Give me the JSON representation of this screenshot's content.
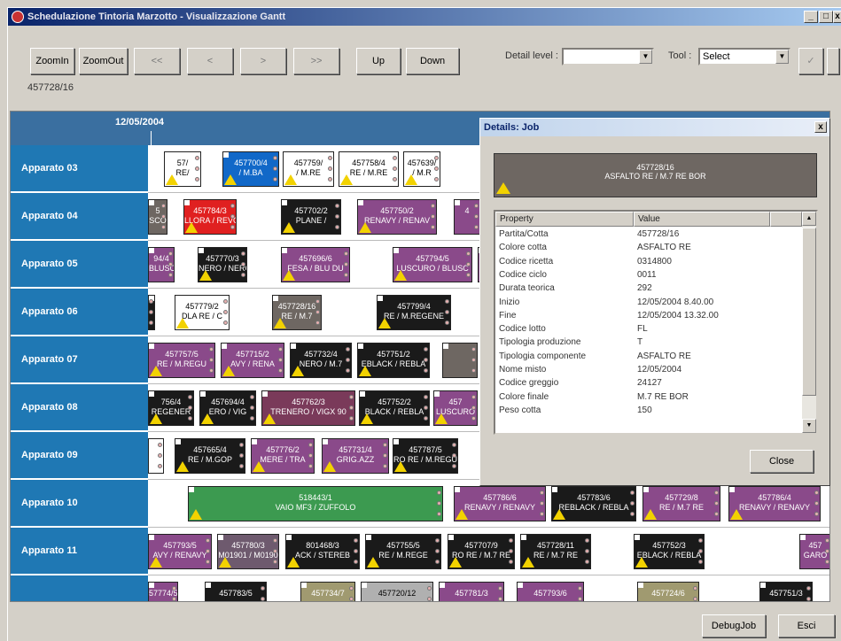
{
  "window": {
    "title": "Schedulazione Tintoria Marzotto - Visualizzazione Gantt",
    "minimize": "_",
    "maximize": "□",
    "close": "x"
  },
  "toolbar": {
    "zoomin": "ZoomIn",
    "zoomout": "ZoomOut",
    "first": "<<",
    "prev": "<",
    "next": ">",
    "last": ">>",
    "up": "Up",
    "down": "Down",
    "detail_label": "Detail level :",
    "detail_value": "",
    "tool_label": "Tool :",
    "tool_value": "Select",
    "check": "✓",
    "selected_job": "457728/16"
  },
  "gantt": {
    "date": "12/05/2004",
    "rows": [
      {
        "label": "Apparato 03",
        "jobs": [
          {
            "l1": "57/",
            "l2": "RE/",
            "color": "#ffffff",
            "text": "#000"
          },
          {
            "l1": "457700/4",
            "l2": "/ M.BA",
            "color": "#1168c8",
            "text": "#fff"
          },
          {
            "l1": "457759/",
            "l2": "/ M.RE",
            "color": "#ffffff",
            "text": "#000"
          },
          {
            "l1": "457758/4",
            "l2": "RE / M.RE",
            "color": "#ffffff",
            "text": "#000"
          },
          {
            "l1": "457639/",
            "l2": "/ M.R",
            "color": "#ffffff",
            "text": "#000"
          }
        ]
      },
      {
        "label": "Apparato 04",
        "jobs": [
          {
            "l1": "5",
            "l2": "SCO",
            "color": "#6e6762",
            "text": "#fff"
          },
          {
            "l1": "457784/3",
            "l2": "LLORA / REVO",
            "color": "#e02020",
            "text": "#fff"
          },
          {
            "l1": "457702/2",
            "l2": "PLANE /",
            "color": "#1a1a1a",
            "text": "#fff"
          },
          {
            "l1": "457750/2",
            "l2": "RENAVY / RENAV",
            "color": "#8a4a8a",
            "text": "#fff"
          },
          {
            "l1": "4",
            "l2": "",
            "color": "#8a4a8a",
            "text": "#fff"
          }
        ]
      },
      {
        "label": "Apparato 05",
        "jobs": [
          {
            "l1": "94/4",
            "l2": "BLUSCU",
            "color": "#8a4a8a",
            "text": "#fff"
          },
          {
            "l1": "457770/3",
            "l2": "NERO / NERO",
            "color": "#1a1a1a",
            "text": "#fff"
          },
          {
            "l1": "457696/6",
            "l2": "FESA / BLU DU",
            "color": "#8a4a8a",
            "text": "#fff"
          },
          {
            "l1": "457794/5",
            "l2": "LUSCURO / BLUSC",
            "color": "#8a4a8a",
            "text": "#fff"
          },
          {
            "l1": "4",
            "l2": "",
            "color": "#8a4a8a",
            "text": "#fff"
          }
        ]
      },
      {
        "label": "Apparato 06",
        "jobs": [
          {
            "l1": "",
            "l2": "",
            "color": "#1a1a1a",
            "text": "#fff"
          },
          {
            "l1": "457779/2",
            "l2": "DLA RE / C",
            "color": "#ffffff",
            "text": "#000"
          },
          {
            "l1": "457728/16",
            "l2": "RE / M.7",
            "color": "#6e6762",
            "text": "#fff"
          },
          {
            "l1": "457799/4",
            "l2": "RE / M.REGENE",
            "color": "#1a1a1a",
            "text": "#fff"
          }
        ]
      },
      {
        "label": "Apparato 07",
        "jobs": [
          {
            "l1": "457757/5",
            "l2": "RE / M.REGU",
            "color": "#8a4a8a",
            "text": "#fff"
          },
          {
            "l1": "457715/2",
            "l2": "AVY / RENA",
            "color": "#8a4a8a",
            "text": "#fff"
          },
          {
            "l1": "457732/4",
            "l2": "NERO / M.7",
            "color": "#1a1a1a",
            "text": "#fff"
          },
          {
            "l1": "457751/2",
            "l2": "EBLACK / REBLA",
            "color": "#1a1a1a",
            "text": "#fff"
          },
          {
            "l1": "",
            "l2": "",
            "color": "#6e6762",
            "text": "#fff"
          }
        ]
      },
      {
        "label": "Apparato 08",
        "jobs": [
          {
            "l1": "756/4",
            "l2": "REGENER",
            "color": "#1a1a1a",
            "text": "#fff"
          },
          {
            "l1": "457694/4",
            "l2": "ERO / VIG",
            "color": "#1a1a1a",
            "text": "#fff"
          },
          {
            "l1": "457762/3",
            "l2": "TRENERO / VIGX 90",
            "color": "#7a3a5a",
            "text": "#fff"
          },
          {
            "l1": "457752/2",
            "l2": "BLACK / REBLA",
            "color": "#1a1a1a",
            "text": "#fff"
          },
          {
            "l1": "457",
            "l2": "LUSCURO",
            "color": "#8a4a8a",
            "text": "#fff"
          }
        ]
      },
      {
        "label": "Apparato 09",
        "jobs": [
          {
            "l1": "",
            "l2": "",
            "color": "#ffffff",
            "text": "#000"
          },
          {
            "l1": "457665/4",
            "l2": "RE / M.GOP",
            "color": "#1a1a1a",
            "text": "#fff"
          },
          {
            "l1": "457776/2",
            "l2": "MERE / TRA",
            "color": "#8a4a8a",
            "text": "#fff"
          },
          {
            "l1": "457731/4",
            "l2": "GRIG.AZZ",
            "color": "#8a4a8a",
            "text": "#fff"
          },
          {
            "l1": "457787/5",
            "l2": "RO RE / M.REGU",
            "color": "#1a1a1a",
            "text": "#fff"
          }
        ]
      },
      {
        "label": "Apparato 10",
        "jobs": [
          {
            "l1": "518443/1",
            "l2": "VAIO MF3 / ZUFFOLO",
            "color": "#3c9a50",
            "text": "#fff"
          },
          {
            "l1": "457786/6",
            "l2": "RENAVY / RENAVY",
            "color": "#8a4a8a",
            "text": "#fff"
          },
          {
            "l1": "457783/6",
            "l2": "REBLACK / REBLA",
            "color": "#1a1a1a",
            "text": "#fff"
          },
          {
            "l1": "457729/8",
            "l2": "RE / M.7 RE",
            "color": "#8a4a8a",
            "text": "#fff"
          },
          {
            "l1": "457786/4",
            "l2": "RENAVY / RENAVY",
            "color": "#8a4a8a",
            "text": "#fff"
          }
        ]
      },
      {
        "label": "Apparato 11",
        "jobs": [
          {
            "l1": "457793/5",
            "l2": "AVY / RENAVY",
            "color": "#8a4a8a",
            "text": "#fff"
          },
          {
            "l1": "457780/3",
            "l2": "M01901 / M0190",
            "color": "#6e5a6e",
            "text": "#fff"
          },
          {
            "l1": "801468/3",
            "l2": "ACK / STEREB",
            "color": "#1a1a1a",
            "text": "#fff"
          },
          {
            "l1": "457755/5",
            "l2": "RE / M.REGE",
            "color": "#1a1a1a",
            "text": "#fff"
          },
          {
            "l1": "457707/9",
            "l2": "RO RE / M.7 RE",
            "color": "#1a1a1a",
            "text": "#fff"
          },
          {
            "l1": "457728/11",
            "l2": "RE / M.7 RE",
            "color": "#1a1a1a",
            "text": "#fff"
          },
          {
            "l1": "457752/3",
            "l2": "EBLACK / REBLA",
            "color": "#1a1a1a",
            "text": "#fff"
          },
          {
            "l1": "457",
            "l2": "GARO",
            "color": "#8a4a8a",
            "text": "#fff"
          }
        ]
      },
      {
        "label": "",
        "jobs": [
          {
            "l1": "57774/5",
            "l2": "",
            "color": "#8a4a8a",
            "text": "#fff"
          },
          {
            "l1": "457783/5",
            "l2": "",
            "color": "#1a1a1a",
            "text": "#fff"
          },
          {
            "l1": "457734/7",
            "l2": "",
            "color": "#a09a70",
            "text": "#fff"
          },
          {
            "l1": "457720/12",
            "l2": "",
            "color": "#b0b0b0",
            "text": "#000"
          },
          {
            "l1": "457781/3",
            "l2": "",
            "color": "#8a4a8a",
            "text": "#fff"
          },
          {
            "l1": "457793/6",
            "l2": "",
            "color": "#8a4a8a",
            "text": "#fff"
          },
          {
            "l1": "457724/6",
            "l2": "",
            "color": "#a09a70",
            "text": "#fff"
          },
          {
            "l1": "457751/3",
            "l2": "",
            "color": "#1a1a1a",
            "text": "#fff"
          }
        ]
      }
    ]
  },
  "details": {
    "title": "Details: Job",
    "close_x": "x",
    "job_id": "457728/16",
    "job_desc": "ASFALTO RE / M.7 RE BOR",
    "col_property": "Property",
    "col_value": "Value",
    "props": [
      {
        "k": "Partita/Cotta",
        "v": "457728/16"
      },
      {
        "k": "Colore cotta",
        "v": "ASFALTO RE"
      },
      {
        "k": "Codice ricetta",
        "v": "0314800"
      },
      {
        "k": "Codice ciclo",
        "v": "0011"
      },
      {
        "k": "Durata teorica",
        "v": "292"
      },
      {
        "k": "Inizio",
        "v": "12/05/2004 8.40.00"
      },
      {
        "k": "Fine",
        "v": "12/05/2004 13.32.00"
      },
      {
        "k": "Codice lotto",
        "v": "FL"
      },
      {
        "k": "Tipologia produzione",
        "v": "T"
      },
      {
        "k": "Tipologia componente",
        "v": "ASFALTO RE"
      },
      {
        "k": "Nome misto",
        "v": "12/05/2004"
      },
      {
        "k": "Codice greggio",
        "v": "24127"
      },
      {
        "k": "Colore finale",
        "v": "M.7 RE BOR"
      },
      {
        "k": "Peso cotta",
        "v": "150"
      }
    ],
    "close_button": "Close"
  },
  "footer": {
    "debug": "DebugJob",
    "exit": "Esci"
  }
}
